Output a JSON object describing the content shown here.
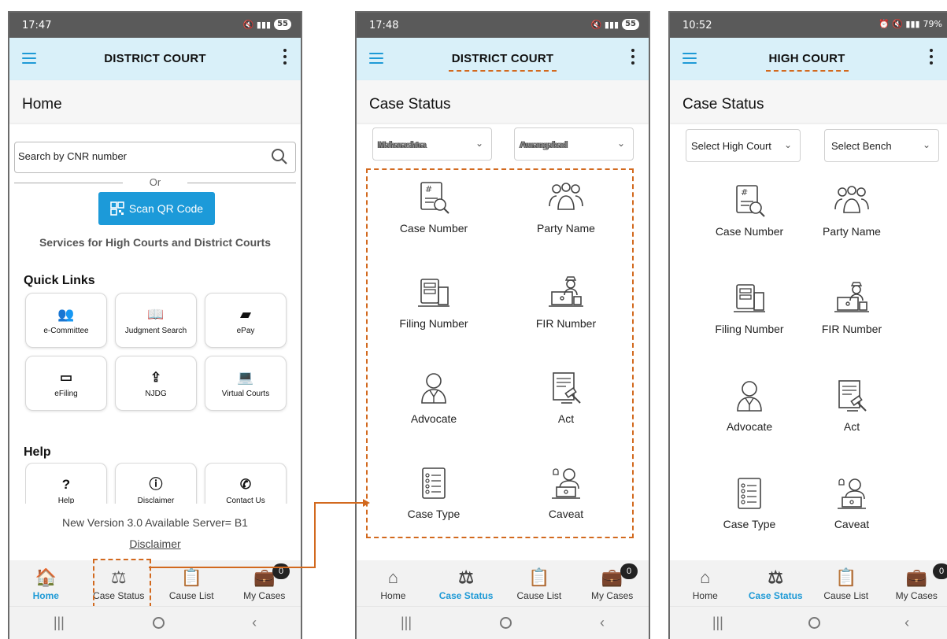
{
  "phone1": {
    "status_time": "17:47",
    "battery": "55",
    "app_title": "DISTRICT COURT",
    "page_title": "Home",
    "search_placeholder": "Search by CNR number",
    "or_text": "Or",
    "qr_button": "Scan QR Code",
    "services_text": "Services for High Courts and District Courts",
    "quick_links_heading": "Quick Links",
    "quick_links": [
      {
        "label": "e-Committee",
        "icon": "people-icon"
      },
      {
        "label": "Judgment Search",
        "icon": "book-icon"
      },
      {
        "label": "ePay",
        "icon": "wallet-icon"
      },
      {
        "label": "eFiling",
        "icon": "window-icon"
      },
      {
        "label": "NJDG",
        "icon": "upload-icon"
      },
      {
        "label": "Virtual Courts",
        "icon": "laptop-icon"
      }
    ],
    "help_heading": "Help",
    "help_links": [
      {
        "label": "Help",
        "icon": "question-icon"
      },
      {
        "label": "Disclaimer",
        "icon": "info-icon"
      },
      {
        "label": "Contact Us",
        "icon": "phone-icon"
      }
    ],
    "version_text": "New Version 3.0 Available Server= B1",
    "disclaimer_link": "Disclaimer",
    "nav": [
      "Home",
      "Case Status",
      "Cause List",
      "My Cases"
    ],
    "badge": "0"
  },
  "phone2": {
    "status_time": "17:48",
    "battery": "55",
    "app_title": "DISTRICT COURT",
    "page_title": "Case Status",
    "state_select": "Maharashtra",
    "district_select": "Aurangabad",
    "options": [
      "Case Number",
      "Party Name",
      "Filing Number",
      "FIR Number",
      "Advocate",
      "Act",
      "Case Type",
      "Caveat"
    ],
    "nav": [
      "Home",
      "Case Status",
      "Cause List",
      "My Cases"
    ],
    "badge": "0"
  },
  "phone3": {
    "status_time": "10:52",
    "battery": "79%",
    "app_title": "HIGH COURT",
    "page_title": "Case Status",
    "court_select": "Select High Court",
    "bench_select": "Select Bench",
    "options": [
      "Case Number",
      "Party Name",
      "Filing Number",
      "FIR Number",
      "Advocate",
      "Act",
      "Case Type",
      "Caveat"
    ],
    "nav": [
      "Home",
      "Case Status",
      "Cause List",
      "My Cases"
    ],
    "badge": "0"
  },
  "colors": {
    "accent": "#1e9ad6",
    "appbar": "#d9f0f9",
    "annotation": "#d2691e"
  }
}
